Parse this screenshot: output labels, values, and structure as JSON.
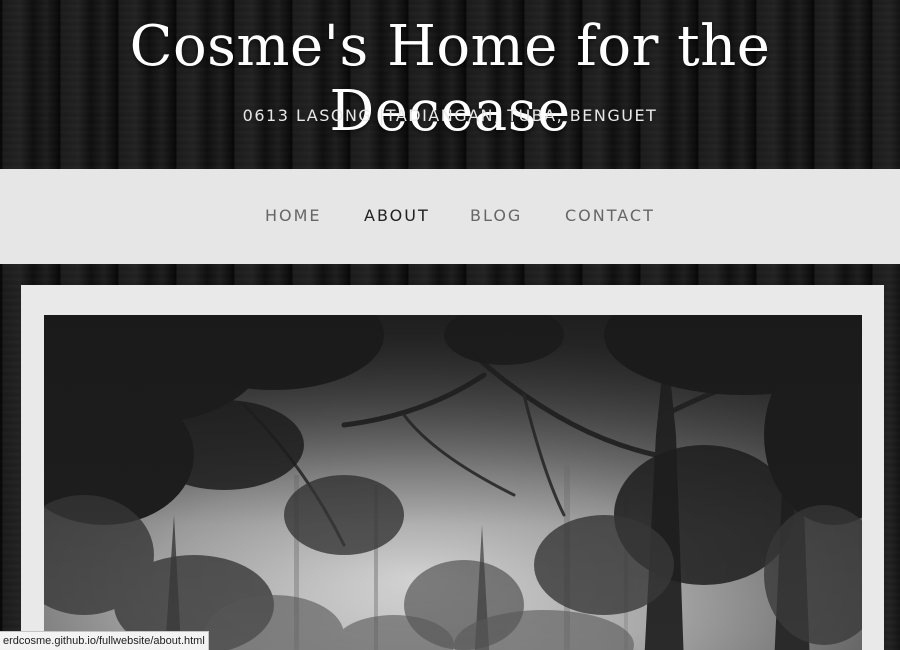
{
  "header": {
    "title": "Cosme's Home for the Decease",
    "address": "0613 LASONG |TADIANGAN, TUBA, BENGUET"
  },
  "nav": {
    "items": [
      {
        "label": "HOME",
        "active": false
      },
      {
        "label": "ABOUT",
        "active": true
      },
      {
        "label": "BLOG",
        "active": false
      },
      {
        "label": "CONTACT",
        "active": false
      }
    ]
  },
  "main": {
    "photo_description_icon": "forest-photo"
  },
  "status_bar": {
    "url": "erdcosme.github.io/fullwebsite/about.html"
  },
  "colors": {
    "background": "#141414",
    "nav_background": "#e6e6e6",
    "panel_background": "#e9e9e9",
    "title_text": "#ffffff",
    "nav_text": "#666666",
    "nav_active_text": "#222222"
  }
}
